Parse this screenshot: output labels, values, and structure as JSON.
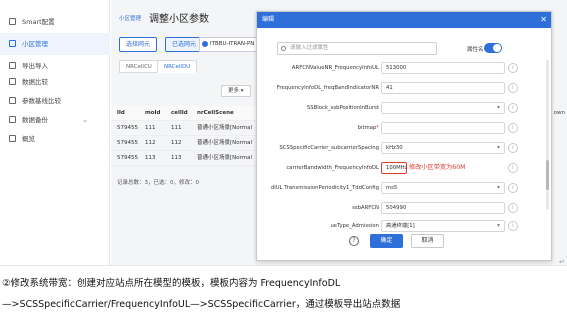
{
  "sidebar": {
    "items": [
      {
        "label": "Smart配置",
        "icon": "gear-icon"
      },
      {
        "label": "小区管理",
        "icon": "cell-icon"
      },
      {
        "label": "导出导入",
        "icon": "export-icon"
      },
      {
        "label": "数据比较",
        "icon": "compare-icon"
      },
      {
        "label": "参数基线比较",
        "icon": "baseline-icon"
      },
      {
        "label": "数据备份",
        "icon": "backup-icon"
      },
      {
        "label": "概览",
        "icon": "overview-icon"
      }
    ]
  },
  "main": {
    "breadcrumb": "小区管理",
    "title": "调整小区参数",
    "select_ne_button": "选择网元",
    "selected_ne_button": "已选网元",
    "selected_ne_tag": "ITBBU-ITRAN-PN",
    "tabs": [
      "NRCellCU",
      "NRCellDU"
    ],
    "more_button": "更多",
    "table": {
      "headers": [
        "lId",
        "moId",
        "cellId",
        "nrCellScene"
      ],
      "right_header": "own",
      "rows": [
        [
          "579455",
          "111",
          "111",
          "普通小区场景[Normal"
        ],
        [
          "579455",
          "112",
          "112",
          "普通小区场景[Normal"
        ],
        [
          "579455",
          "113",
          "113",
          "普通小区场景[Normal"
        ]
      ],
      "footer": "记录总数：3，已选：0，修改：0"
    }
  },
  "dialog": {
    "title": "编辑",
    "search_placeholder": "请输入过滤属性",
    "sort_label": "属性名",
    "fields": [
      {
        "label": "ARFCNValueNR_FrequencyInfoUL",
        "value": "513000",
        "type": "input",
        "required": false
      },
      {
        "label": "FrequencyInfoDL_freqBandIndicatorNR",
        "value": "41",
        "type": "input",
        "required": false
      },
      {
        "label": "SSBlock_ssbPositionInBurst",
        "value": "",
        "type": "select",
        "required": false
      },
      {
        "label": "bitmap",
        "value": "",
        "type": "input",
        "required": true
      },
      {
        "label": "SCSSpecificCarrier_subcarrierSpacing",
        "value": "kHz30",
        "type": "select",
        "required": false
      },
      {
        "label": "carrierBandwidth_FrequencyInfoDL",
        "value": "100MHz[100]",
        "type": "select",
        "required": false
      },
      {
        "label": "dlUL TransmissionPeriodicity1_TddConfig",
        "value": "ms5",
        "type": "select",
        "required": false
      },
      {
        "label": "ssbARFCN",
        "value": "504990",
        "type": "input",
        "required": false
      },
      {
        "label": "ueType_Admission",
        "value": "高通终端[1]",
        "type": "select",
        "required": false
      }
    ],
    "annotation": "修改小区带宽为60M",
    "ok_button": "确定",
    "cancel_button": "取消",
    "accent_color": "#2f6fd9",
    "annotation_color": "#e03a2f"
  },
  "caption": {
    "line1": "②修改系统带宽：创建对应站点所在模型的模板，模板内容为 FrequencyInfoDL",
    "line2": "—>SCSSpecificCarrier/FrequencyInfoUL—>SCSSpecificCarrier，通过模板导出站点数据"
  }
}
